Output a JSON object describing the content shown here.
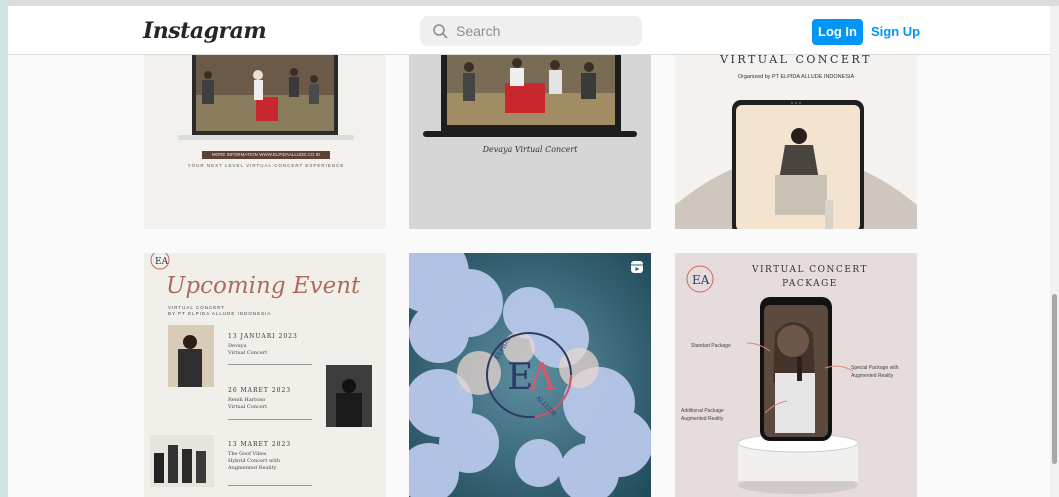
{
  "header": {
    "logo": "Instagram",
    "search_placeholder": "Search",
    "login_label": "Log In",
    "signup_label": "Sign Up"
  },
  "posts": {
    "p1": {
      "banner": "MORE INFORMATION WWW.ELPIDAALLUDE.CO.ID",
      "tagline": "YOUR NEXT LEVEL VIRTUAL CONCERT EXPERIENCE"
    },
    "p2": {
      "caption": "Devaya Virtual Concert"
    },
    "p3": {
      "title": "VIRTUAL CONCERT",
      "organizer": "Organized by  PT ELPIDA ALLUDE INDONESIA"
    },
    "p4": {
      "title": "Upcoming Event",
      "subtitle1": "VIRTUAL CONCERT",
      "subtitle2": "BY PT ELPIDA ALLUDE INDONESIA",
      "events": [
        {
          "date": "13 JANUARI 2023",
          "name1": "Devaya",
          "name2": "Virtual Concert",
          "name3": ""
        },
        {
          "date": "26 MARET 2023",
          "name1": "Rendi Hartono",
          "name2": "Virtual Concert",
          "name3": ""
        },
        {
          "date": "13 MARET 2023",
          "name1": "The Goof Vibes",
          "name2": "Hybrid Concert with",
          "name3": "Augmented Reality"
        }
      ]
    },
    "p5": {
      "logo_letters": "EA",
      "ring_text_left": "ELPIDA",
      "ring_text_right": "ALLUDE"
    },
    "p6": {
      "title1": "VIRTUAL CONCERT",
      "title2": "PACKAGE",
      "standard": "Standart Package",
      "special1": "Special Package with",
      "special2": "Augmented Reality",
      "additional1": "Additional Package",
      "additional2": "Augmented Reality"
    }
  }
}
